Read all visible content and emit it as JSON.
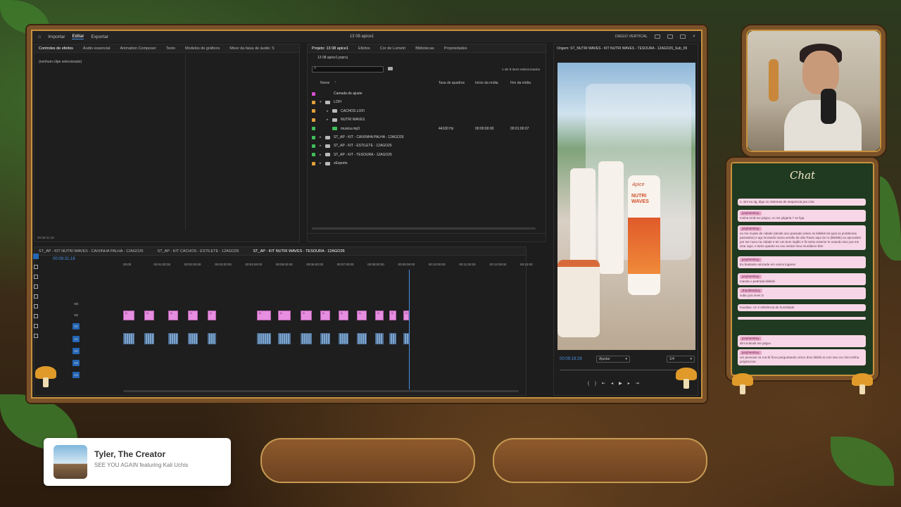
{
  "premiere": {
    "workspaces": [
      "Importar",
      "Editar",
      "Exportar"
    ],
    "active_workspace": "Editar",
    "project_title": "13 08 apice1",
    "user": "DIEGO VERTICAL",
    "left_tabs": [
      "Controles de efeitos",
      "Áudio essencial",
      "Animation Composer",
      "Texto",
      "Modelos de gráficos",
      "Mixer da faixa de áudio: S"
    ],
    "no_clip": "(nenhum clipe selecionado)",
    "left_timecode": "00:09:31:18",
    "project_tabs": [
      "Projeto: 13 08 apice1",
      "Efeitos",
      "Cor de Lumetri",
      "Bibliotecas",
      "Propriedades"
    ],
    "project_file": "13 08 apice1.prproj",
    "items_selected": "1 de 9 itens selecionados",
    "columns": [
      "Nome",
      "Taxa de quadros",
      "Início da mídia",
      "Fim da mídia"
    ],
    "items": [
      {
        "name": "Camada de ajuste",
        "color": "#d84fd6",
        "kind": "item",
        "depth": 0
      },
      {
        "name": "LOFI",
        "color": "#e3a03a",
        "kind": "folder",
        "depth": 0,
        "open": true
      },
      {
        "name": "CACHOS LOFI",
        "color": "#e3a03a",
        "kind": "folder",
        "depth": 1
      },
      {
        "name": "NUTRI WAVES",
        "color": "#e3a03a",
        "kind": "folder",
        "depth": 1
      },
      {
        "name": "musica.mp3",
        "color": "#3fbf5a",
        "kind": "audio",
        "depth": 1,
        "rate": "44100 Hz",
        "start": "00:00:00:00",
        "end": "00:01:00:07"
      },
      {
        "name": "ST_AP - KIT - CAIXINHA PALHA - 12AGO26",
        "color": "#3fbf5a",
        "kind": "folder",
        "depth": 0
      },
      {
        "name": "ST_AP - KIT - ESTILETE - 12AGO26",
        "color": "#3fbf5a",
        "kind": "folder",
        "depth": 0
      },
      {
        "name": "ST_AP - KIT - TESOURA - 12AGO26",
        "color": "#3fbf5a",
        "kind": "folder",
        "depth": 0
      },
      {
        "name": "zExports",
        "color": "#e3a03a",
        "kind": "folder",
        "depth": 0
      }
    ],
    "source_title": "Origem: ST_NUTRI WAVES - KIT NUTRI WAVES - TESOURA - 12AGO26_Sub_09",
    "source_timecode": "00:09:19:29",
    "source_fit": "Ajustar",
    "source_res": "1/4",
    "bottle_brand": "Apice",
    "bottle_label": "NUTRI WAVES",
    "timeline_tabs": [
      "ST_AP - KIT NUTRI WAVES - CAIXINHA PALHA - 12AGO26",
      "ST_AP - KIT CACHOS - ESTILETE - 12AGO26",
      "ST_AP - KIT NUTRI WAVES - TESOURA - 12AGO26"
    ],
    "timeline_timecode": "00:09:31:18",
    "ruler": [
      "00:00",
      "00:01:00:00",
      "00:02:00:00",
      "00:03:00:00",
      "00:04:00:00",
      "00:05:00:00",
      "00:06:00:00",
      "00:07:00:00",
      "00:08:00:00",
      "00:09:00:00",
      "00:10:00:00",
      "00:11:00:00",
      "00:12:00:00",
      "00:13:00"
    ],
    "video_tracks": [
      "V3",
      "V2",
      "V1"
    ],
    "audio_tracks": [
      "A1",
      "A2",
      "A3",
      "A4"
    ],
    "clip_fx": "fx"
  },
  "chat": {
    "title": "Chat",
    "messages": [
      {
        "user": "",
        "text": "n, sim eu tig, digo os sistemas de sequencia pra criar"
      },
      {
        "user": "junyhereboy",
        "text": "minha irmã me julgou, vc me julgaria ? se liga"
      },
      {
        "user": "junyhereboy",
        "text": "eu me mudei de cidade (desde ano passado antes 4x kkkkkk tal qual os problemas passados) e agr morando numa versão de são Paulo aqui do rs (kkkkkk) eu aproveitei por ser novo na cidade e ter um bom inglês e fiz tanto exterior te usando isso pra me virar aqui, e tanto quanto eu vou sentar meu murdiamo tbm"
      },
      {
        "user": "junyhereboy",
        "text": "Eu bastante amizade em varios lugares"
      },
      {
        "user": "junyhereboy",
        "text": "manda o pedrada kkkkkk"
      },
      {
        "user": "Jhontheuboy",
        "text": "subiu pra nivel 2!"
      },
      {
        "user": "",
        "text": "hoxdiwn, Vc é referência de humildade"
      },
      {
        "user": "",
        "text": ""
      },
      {
        "user": "junyhereboy",
        "text": "slim kokusk me julgou"
      },
      {
        "user": "junyhereboy",
        "text": "um pessoas na rua tb ficou perguntando cesco dmo kkkkk ai com isso eu criei minha própria lore"
      }
    ]
  },
  "now_playing": {
    "artist": "Tyler, The Creator",
    "song": "SEE YOU AGAIN featuring Kali Uchis"
  },
  "colors": {
    "clip_video": "#e68ee0",
    "clip_audio": "#7ea5cf",
    "playhead": "#4a90e2",
    "frame_wood": "#7a5128"
  }
}
